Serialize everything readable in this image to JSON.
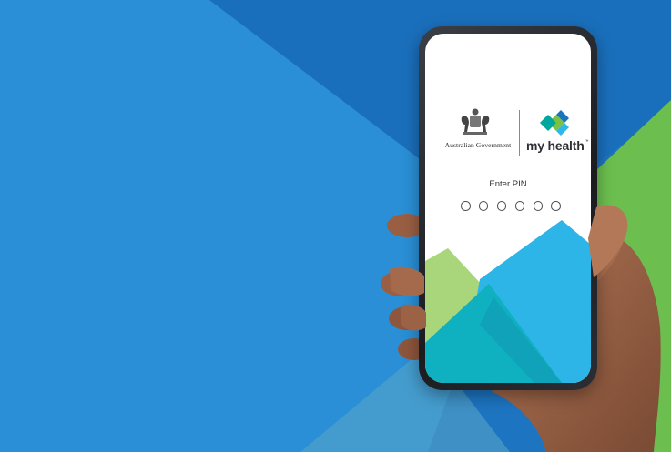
{
  "screen": {
    "government_label": "Australian Government",
    "app_name": "my health",
    "trademark": "™",
    "pin_prompt": "Enter PIN",
    "pin_length": 6
  },
  "icons": {
    "coat_of_arms": "coat-of-arms-icon",
    "my_health_logo": "my-health-logo-icon"
  },
  "colors": {
    "background_blue": "#2a8fd6",
    "dark_blue": "#1a6fbc",
    "light_green": "#a9d67a",
    "green": "#6cbf4f",
    "teal": "#0fb0bf",
    "sky_blue": "#2eb5e8",
    "screen_white": "#ffffff"
  }
}
